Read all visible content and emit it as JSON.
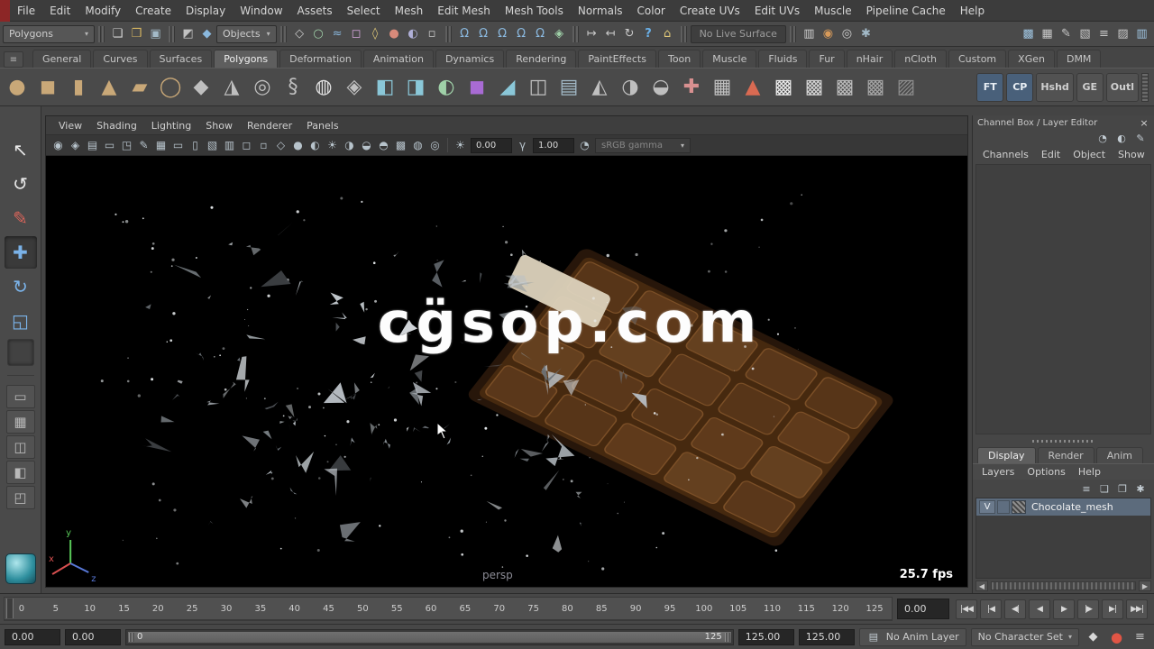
{
  "colors": {
    "viewport_bg": "#000000",
    "chocolate_brown": "#5d3a1d",
    "debris_gray": "#b9c0c6",
    "autokey_red": "#e05545",
    "layer_selected_bg": "#5c6b7c"
  },
  "menubar": {
    "items": [
      "File",
      "Edit",
      "Modify",
      "Create",
      "Display",
      "Window",
      "Assets",
      "Select",
      "Mesh",
      "Edit Mesh",
      "Mesh Tools",
      "Normals",
      "Color",
      "Create UVs",
      "Edit UVs",
      "Muscle",
      "Pipeline Cache",
      "Help"
    ]
  },
  "statusline": {
    "mode": "Polygons",
    "dropdown_arrow": "▾",
    "scene_icons": [
      {
        "name": "new-scene-icon",
        "glyph": "❏",
        "style": "color:#d6d6d6"
      },
      {
        "name": "open-scene-icon",
        "glyph": "❒",
        "style": "color:#d8b761"
      },
      {
        "name": "save-scene-icon",
        "glyph": "▣",
        "style": "color:#a3bac8"
      }
    ],
    "selection_icons": [
      {
        "name": "select-hierarchy-icon",
        "glyph": "◩",
        "style": "color:#c2c2c2"
      },
      {
        "name": "select-object-icon",
        "glyph": "◆",
        "style": "color:#8ab8de"
      }
    ],
    "selection_mask_label": "Objects",
    "mask_icons": [
      {
        "name": "mask-handles-icon",
        "glyph": "◇",
        "style": "color:#c8c8c8"
      },
      {
        "name": "mask-joints-icon",
        "glyph": "○",
        "style": "color:#9fd0a8"
      },
      {
        "name": "mask-curves-icon",
        "glyph": "≈",
        "style": "color:#8ab8de"
      },
      {
        "name": "mask-surfaces-icon",
        "glyph": "◻",
        "style": "color:#d8a8e0"
      },
      {
        "name": "mask-deformers-icon",
        "glyph": "◊",
        "style": "color:#e0c878"
      },
      {
        "name": "mask-dynamics-icon",
        "glyph": "●",
        "style": "color:#d88a7a"
      },
      {
        "name": "mask-rendering-icon",
        "glyph": "◐",
        "style": "color:#b0b0d8"
      },
      {
        "name": "mask-misc-icon",
        "glyph": "▫",
        "style": "color:#c8c8c8"
      }
    ],
    "snap_icons": [
      {
        "name": "snap-to-grid-icon",
        "glyph": "Ω",
        "style": "color:#8ab8de"
      },
      {
        "name": "snap-to-curve-icon",
        "glyph": "Ω",
        "style": "color:#8ab8de"
      },
      {
        "name": "snap-to-point-icon",
        "glyph": "Ω",
        "style": "color:#8ab8de"
      },
      {
        "name": "snap-to-projected-center-icon",
        "glyph": "Ω",
        "style": "color:#8ab8de"
      },
      {
        "name": "snap-to-view-plane-icon",
        "glyph": "Ω",
        "style": "color:#8ab8de"
      },
      {
        "name": "make-live-icon",
        "glyph": "◈",
        "style": "color:#9fd0a8"
      }
    ],
    "history_icons": [
      {
        "name": "input-connections-icon",
        "glyph": "↦",
        "style": "color:#c8c8c8"
      },
      {
        "name": "output-connections-icon",
        "glyph": "↤",
        "style": "color:#c8c8c8"
      },
      {
        "name": "construction-history-icon",
        "glyph": "↻",
        "style": "color:#c8c8c8"
      },
      {
        "name": "quick-help-icon",
        "glyph": "?",
        "style": "color:#6ab0e8;font-weight:bold"
      },
      {
        "name": "lock-selection-icon",
        "glyph": "⌂",
        "style": "color:#e0c878"
      }
    ],
    "live_surface": "No Live Surface",
    "render_icons": [
      {
        "name": "open-render-view-icon",
        "glyph": "▥",
        "style": "color:#cfcfcf"
      },
      {
        "name": "render-current-frame-icon",
        "glyph": "◉",
        "style": "color:#d79a5a"
      },
      {
        "name": "ipr-render-icon",
        "glyph": "◎",
        "style": "color:#cfcfcf"
      },
      {
        "name": "render-settings-icon",
        "glyph": "✱",
        "style": "color:#a3bac8"
      }
    ],
    "sidebar_icons": [
      {
        "name": "modeling-toolkit-icon",
        "glyph": "▩",
        "style": "color:#9fc4e0"
      },
      {
        "name": "hypershade-icon",
        "glyph": "▦",
        "style": "color:#c8c8c8"
      },
      {
        "name": "paint-effects-icon",
        "glyph": "✎",
        "style": "color:#c8c8c8"
      },
      {
        "name": "uv-editor-icon",
        "glyph": "▧",
        "style": "color:#c8c8c8"
      },
      {
        "name": "attribute-editor-icon",
        "glyph": "≡",
        "style": "color:#c8c8c8"
      },
      {
        "name": "tool-settings-icon",
        "glyph": "▨",
        "style": "color:#c8c8c8"
      },
      {
        "name": "channel-box-icon",
        "glyph": "▥",
        "style": "color:#9fc4e0"
      }
    ]
  },
  "shelf": {
    "tab_menu_glyph": "≡",
    "tabs": [
      "General",
      "Curves",
      "Surfaces",
      "Polygons",
      "Deformation",
      "Animation",
      "Dynamics",
      "Rendering",
      "PaintEffects",
      "Toon",
      "Muscle",
      "Fluids",
      "Fur",
      "nHair",
      "nCloth",
      "Custom",
      "XGen",
      "DMM"
    ],
    "active_tab": "Polygons",
    "icons": [
      {
        "name": "poly-sphere-icon",
        "glyph": "●",
        "style": "color:#c9a878"
      },
      {
        "name": "poly-cube-icon",
        "glyph": "◼",
        "style": "color:#c9a878"
      },
      {
        "name": "poly-cylinder-icon",
        "glyph": "▮",
        "style": "color:#c9a878"
      },
      {
        "name": "poly-cone-icon",
        "glyph": "▲",
        "style": "color:#c9a878"
      },
      {
        "name": "poly-plane-icon",
        "glyph": "▰",
        "style": "color:#c9a878"
      },
      {
        "name": "poly-torus-icon",
        "glyph": "◯",
        "style": "color:#c9a878"
      },
      {
        "name": "poly-prism-icon",
        "glyph": "◆",
        "style": "color:#bfbfbf"
      },
      {
        "name": "poly-pyramid-icon",
        "glyph": "◮",
        "style": "color:#bfbfbf"
      },
      {
        "name": "poly-pipe-icon",
        "glyph": "◎",
        "style": "color:#bfbfbf"
      },
      {
        "name": "poly-helix-icon",
        "glyph": "§",
        "style": "color:#bfbfbf"
      },
      {
        "name": "poly-soccer-ball-icon",
        "glyph": "◍",
        "style": "color:#e0e0e0"
      },
      {
        "name": "poly-platonic-solids-icon",
        "glyph": "◈",
        "style": "color:#bfbfbf"
      },
      {
        "name": "combine-icon",
        "glyph": "◧",
        "style": "color:#8ac7d8"
      },
      {
        "name": "separate-icon",
        "glyph": "◨",
        "style": "color:#8ac7d8"
      },
      {
        "name": "smooth-icon",
        "glyph": "◐",
        "style": "color:#9fd0a8"
      },
      {
        "name": "interactive-split-icon",
        "glyph": "◼",
        "style": "color:#a86bd4"
      },
      {
        "name": "bevel-icon",
        "glyph": "◢",
        "style": "color:#8ac7d8"
      },
      {
        "name": "bridge-icon",
        "glyph": "◫",
        "style": "color:#bfbfbf"
      },
      {
        "name": "extrude-icon",
        "glyph": "▤",
        "style": "color:#a3bac8"
      },
      {
        "name": "booleans-icon",
        "glyph": "◭",
        "style": "color:#bfbfbf"
      },
      {
        "name": "mirror-geometry-icon",
        "glyph": "◑",
        "style": "color:#bfbfbf"
      },
      {
        "name": "flip-icon",
        "glyph": "◒",
        "style": "color:#bfbfbf"
      },
      {
        "name": "merge-vertices-icon",
        "glyph": "✚",
        "style": "color:#d89090"
      },
      {
        "name": "average-vertices-icon",
        "glyph": "▦",
        "style": "color:#bfbfbf"
      },
      {
        "name": "sculpt-tool-icon",
        "glyph": "▲",
        "style": "color:#d96a52"
      },
      {
        "name": "checker-map-icon-1",
        "glyph": "▩",
        "style": "color:#ececec"
      },
      {
        "name": "checker-map-icon-2",
        "glyph": "▩",
        "style": "color:#d4d4d4"
      },
      {
        "name": "checker-map-icon-3",
        "glyph": "▩",
        "style": "color:#bcbcbc"
      },
      {
        "name": "checker-map-icon-4",
        "glyph": "▩",
        "style": "color:#a4a4a4"
      },
      {
        "name": "uv-snapshot-icon",
        "glyph": "▨",
        "style": "color:#8c8c8c"
      }
    ],
    "buttons": [
      {
        "label": "FT",
        "style": "background:#49607a;color:#e8eef4"
      },
      {
        "label": "CP",
        "style": "background:#49607a;color:#e8eef4"
      },
      {
        "label": "Hshd",
        "style": "color:#d0d0d0"
      },
      {
        "label": "GE",
        "style": "color:#d0d0d0"
      },
      {
        "label": "Outl",
        "style": "color:#d0d0d0"
      }
    ]
  },
  "toolbox": {
    "tools": [
      {
        "name": "select-tool",
        "glyph": "↖",
        "style": "color:#e8e8e8"
      },
      {
        "name": "lasso-tool",
        "glyph": "↺",
        "style": "color:#e8e8e8"
      },
      {
        "name": "paint-select-tool",
        "glyph": "✎",
        "style": "color:#d9645a"
      },
      {
        "name": "move-tool",
        "glyph": "✚",
        "style": "color:#7ab2e8;background:#3a3a3a;box-shadow:inset 0 1px 4px rgba(0,0,0,.6)"
      },
      {
        "name": "rotate-tool",
        "glyph": "↻",
        "style": "color:#7ab2e8"
      },
      {
        "name": "scale-tool",
        "glyph": "◱",
        "style": "color:#7ab2e8"
      },
      {
        "name": "last-tool-slot",
        "glyph": "",
        "style": "width:30px;height:30px;background:#424242;box-shadow:inset 0 0 4px rgba(0,0,0,.55);border:1px solid #383838"
      }
    ],
    "layouts": [
      {
        "name": "layout-single-pane-button",
        "glyph": "▭"
      },
      {
        "name": "layout-four-pane-button",
        "glyph": "▦"
      },
      {
        "name": "layout-two-pane-side-button",
        "glyph": "◫"
      },
      {
        "name": "layout-persp-outliner-button",
        "glyph": "◧"
      },
      {
        "name": "layout-hypergraph-button",
        "glyph": "◰"
      }
    ]
  },
  "panel": {
    "menus": [
      "View",
      "Shading",
      "Lighting",
      "Show",
      "Renderer",
      "Panels"
    ],
    "toolbar": {
      "icons": [
        {
          "name": "camera-select-icon",
          "glyph": "◉"
        },
        {
          "name": "camera-lock-icon",
          "glyph": "◈"
        },
        {
          "name": "camera-bookmark-icon",
          "glyph": "▤"
        },
        {
          "name": "image-plane-icon",
          "glyph": "▭"
        },
        {
          "name": "pan-zoom-2d-icon",
          "glyph": "◳"
        },
        {
          "name": "grease-pencil-icon",
          "glyph": "✎"
        },
        {
          "name": "grid-icon",
          "glyph": "▦"
        },
        {
          "name": "film-gate-icon",
          "glyph": "▭"
        },
        {
          "name": "resolution-gate-icon",
          "glyph": "▯"
        },
        {
          "name": "gate-mask-icon",
          "glyph": "▧"
        },
        {
          "name": "field-chart-icon",
          "glyph": "▥"
        },
        {
          "name": "safe-action-icon",
          "glyph": "◻"
        },
        {
          "name": "safe-title-icon",
          "glyph": "▫"
        },
        {
          "name": "wireframe-icon",
          "glyph": "◇"
        },
        {
          "name": "shaded-icon",
          "glyph": "●"
        },
        {
          "name": "textured-icon",
          "glyph": "◐"
        },
        {
          "name": "use-all-lights-icon",
          "glyph": "☀"
        },
        {
          "name": "shadows-icon",
          "glyph": "◑"
        },
        {
          "name": "screen-space-ao-icon",
          "glyph": "◒"
        },
        {
          "name": "motion-blur-icon",
          "glyph": "◓"
        },
        {
          "name": "multisample-icon",
          "glyph": "▩"
        },
        {
          "name": "xray-icon",
          "glyph": "◍"
        },
        {
          "name": "isolate-select-icon",
          "glyph": "◎"
        }
      ],
      "exposure_icon": "☀",
      "exposure": "0.00",
      "gamma_icon": "γ",
      "gamma": "1.00",
      "cm_icon": "◔",
      "colorspace": "sRGB gamma",
      "dropdown_arrow": "▾"
    }
  },
  "viewport": {
    "watermark": "cg̈sop.com",
    "camera_label": "persp",
    "fps_label": "25.7 fps",
    "axis_labels": {
      "x": "x",
      "y": "y",
      "z": "z"
    }
  },
  "channel_box": {
    "title": "Channel Box / Layer Editor",
    "close_glyph": "×",
    "toolbar_icons": [
      {
        "name": "channel-speed-icon",
        "glyph": "◔"
      },
      {
        "name": "channel-display-icon",
        "glyph": "◐"
      },
      {
        "name": "channel-manip-icon",
        "glyph": "✎"
      }
    ],
    "menus": [
      "Channels",
      "Edit",
      "Object",
      "Show"
    ],
    "layer_editor": {
      "tabs": [
        "Display",
        "Render",
        "Anim"
      ],
      "active_tab": "Display",
      "menus": [
        "Layers",
        "Options",
        "Help"
      ],
      "toolbar_icons": [
        {
          "name": "layer-mode-icon",
          "glyph": "≡"
        },
        {
          "name": "new-empty-layer-icon",
          "glyph": "❏"
        },
        {
          "name": "new-layer-from-selected-icon",
          "glyph": "❐"
        },
        {
          "name": "layer-attributes-icon",
          "glyph": "✱"
        }
      ],
      "layers": [
        {
          "visibility_label": "V",
          "name": "Chocolate_mesh"
        }
      ],
      "scroll_left_glyph": "◀",
      "scroll_right_glyph": "▶"
    }
  },
  "timeline": {
    "ticks": [
      "0",
      "5",
      "10",
      "15",
      "20",
      "25",
      "30",
      "35",
      "40",
      "45",
      "50",
      "55",
      "60",
      "65",
      "70",
      "75",
      "80",
      "85",
      "90",
      "95",
      "100",
      "105",
      "110",
      "115",
      "120",
      "125"
    ],
    "current_frame": "0.00",
    "playback_buttons": [
      {
        "name": "go-to-start-button",
        "glyph": "|◀◀"
      },
      {
        "name": "step-back-one-key-button",
        "glyph": "|◀"
      },
      {
        "name": "step-back-one-frame-button",
        "glyph": "◀|"
      },
      {
        "name": "play-backwards-button",
        "glyph": "◀"
      },
      {
        "name": "play-forwards-button",
        "glyph": "▶"
      },
      {
        "name": "step-forward-one-frame-button",
        "glyph": "|▶"
      },
      {
        "name": "step-forward-one-key-button",
        "glyph": "▶|"
      },
      {
        "name": "go-to-end-button",
        "glyph": "▶▶|"
      }
    ]
  },
  "range_slider": {
    "animation_start": "0.00",
    "playback_start": "0.00",
    "range_start_label": "0",
    "range_end_label": "125",
    "playback_end": "125.00",
    "animation_end": "125.00",
    "anim_layer_icon": "▤",
    "anim_layer_label": "No Anim Layer",
    "character_set_label": "No Character Set",
    "dropdown_arrow": "▾",
    "extra_icons": [
      {
        "name": "set-key-icon",
        "glyph": "◆",
        "style": "color:#d8d8d8"
      },
      {
        "name": "auto-keyframe-button",
        "glyph": "●",
        "style": "color:#e05545;font-size:15px"
      },
      {
        "name": "animation-preferences-icon",
        "glyph": "≡",
        "style": "color:#c8c8c8"
      }
    ]
  }
}
